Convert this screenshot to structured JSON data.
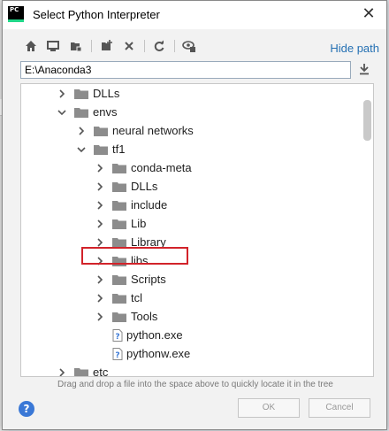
{
  "window": {
    "title": "Select Python Interpreter",
    "app_icon_text": "PC"
  },
  "toolbar": {
    "icons": [
      "home-icon",
      "desktop-icon",
      "project-icon",
      "new-folder-icon",
      "delete-icon",
      "refresh-icon",
      "show-hidden-icon"
    ],
    "hide_path_label": "Hide path"
  },
  "path": {
    "value": "E:\\Anaconda3"
  },
  "tree": {
    "items": [
      {
        "label": "DLLs",
        "kind": "folder",
        "state": "collapsed",
        "level": 0
      },
      {
        "label": "envs",
        "kind": "folder",
        "state": "expanded",
        "level": 0
      },
      {
        "label": "neural networks",
        "kind": "folder",
        "state": "collapsed",
        "level": 1
      },
      {
        "label": "tf1",
        "kind": "folder",
        "state": "expanded",
        "level": 1
      },
      {
        "label": "conda-meta",
        "kind": "folder",
        "state": "collapsed",
        "level": 2
      },
      {
        "label": "DLLs",
        "kind": "folder",
        "state": "collapsed",
        "level": 2
      },
      {
        "label": "include",
        "kind": "folder",
        "state": "collapsed",
        "level": 2
      },
      {
        "label": "Lib",
        "kind": "folder",
        "state": "collapsed",
        "level": 2
      },
      {
        "label": "Library",
        "kind": "folder",
        "state": "collapsed",
        "level": 2
      },
      {
        "label": "libs",
        "kind": "folder",
        "state": "collapsed",
        "level": 2
      },
      {
        "label": "Scripts",
        "kind": "folder",
        "state": "collapsed",
        "level": 2
      },
      {
        "label": "tcl",
        "kind": "folder",
        "state": "collapsed",
        "level": 2
      },
      {
        "label": "Tools",
        "kind": "folder",
        "state": "collapsed",
        "level": 2
      },
      {
        "label": "python.exe",
        "kind": "file",
        "state": "none",
        "level": 2,
        "highlighted": true
      },
      {
        "label": "pythonw.exe",
        "kind": "file",
        "state": "none",
        "level": 2
      },
      {
        "label": "etc",
        "kind": "folder",
        "state": "collapsed",
        "level": 0
      }
    ]
  },
  "hint": "Drag and drop a file into the space above to quickly locate it in the tree",
  "buttons": {
    "ok_label": "OK",
    "cancel_label": "Cancel"
  },
  "colors": {
    "link": "#2470b3",
    "highlight_border": "#d2232a",
    "help": "#3a78d6"
  }
}
